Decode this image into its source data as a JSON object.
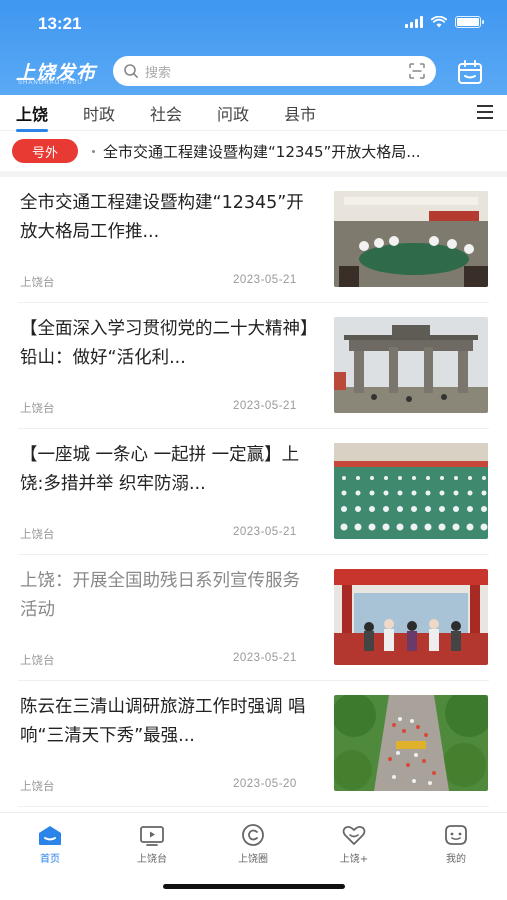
{
  "status_bar": {
    "time": "13:21",
    "battery_level": 1.0
  },
  "header": {
    "logo": "上饶发布",
    "logo_sub": "SHANGRAO FABU",
    "search_placeholder": "搜索"
  },
  "tabs": [
    {
      "label": "上饶",
      "active": true
    },
    {
      "label": "时政",
      "active": false
    },
    {
      "label": "社会",
      "active": false
    },
    {
      "label": "问政",
      "active": false
    },
    {
      "label": "县市",
      "active": false
    }
  ],
  "ticker": {
    "badge": "号外",
    "text": "全市交通工程建设暨构建“12345”开放大格局..."
  },
  "news": [
    {
      "title": "全市交通工程建设暨构建“12345”开放大格局工作推...",
      "source": "上饶台",
      "date": "2023-05-21",
      "read": false,
      "image": "meeting"
    },
    {
      "title": "【全面深入学习贯彻党的二十大精神】铅山：做好“活化利...",
      "source": "上饶台",
      "date": "2023-05-21",
      "read": false,
      "image": "archway"
    },
    {
      "title": "【一座城 一条心 一起拼 一定赢】上饶:多措并举 织牢防溺...",
      "source": "上饶台",
      "date": "2023-05-21",
      "read": false,
      "image": "field"
    },
    {
      "title": "上饶：开展全国助残日系列宣传服务活动",
      "source": "上饶台",
      "date": "2023-05-21",
      "read": true,
      "image": "event"
    },
    {
      "title": "陈云在三清山调研旅游工作时强调 唱响“三清天下秀”最强...",
      "source": "上饶台",
      "date": "2023-05-20",
      "read": false,
      "image": "crowd"
    }
  ],
  "bottom_nav": [
    {
      "label": "首页",
      "icon": "home-icon",
      "active": true
    },
    {
      "label": "上饶台",
      "icon": "tv-icon",
      "active": false
    },
    {
      "label": "上饶圈",
      "icon": "circle-icon",
      "active": false
    },
    {
      "label": "上饶+",
      "icon": "heart-icon",
      "active": false
    },
    {
      "label": "我的",
      "icon": "profile-icon",
      "active": false
    }
  ],
  "colors": {
    "header_blue": "#3f97f0",
    "accent_blue": "#2b84e8",
    "badge_red": "#e83a32"
  }
}
